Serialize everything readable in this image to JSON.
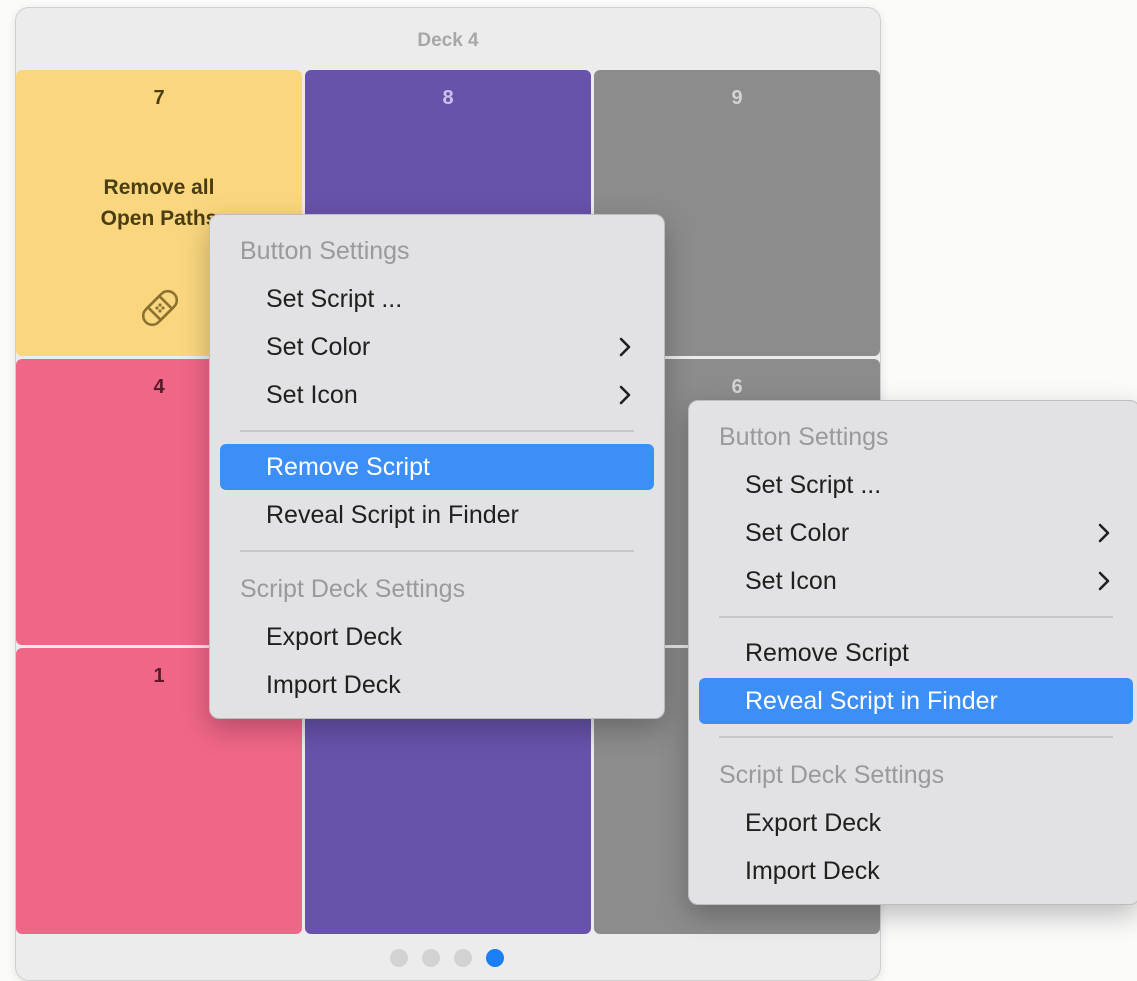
{
  "window": {
    "title": "Deck 4"
  },
  "grid": {
    "cells": [
      {
        "number": "7",
        "label": "Remove all\nOpen Paths",
        "color": "#fad77f",
        "icon": "bandage-icon"
      },
      {
        "number": "8",
        "label": "",
        "color": "#6753aa"
      },
      {
        "number": "9",
        "label": "",
        "color": "#8c8c8c"
      },
      {
        "number": "4",
        "label": "",
        "color": "#f06687"
      },
      {
        "number": "6",
        "label": "",
        "color": "#8c8c8c"
      },
      {
        "number": "1",
        "label": "",
        "color": "#f06687"
      },
      {
        "number": "",
        "label": "",
        "color": "#6753aa"
      },
      {
        "number": "",
        "label": "",
        "color": "#8c8c8c"
      }
    ]
  },
  "page_indicator": {
    "pages": 4,
    "current": 4
  },
  "menus": [
    {
      "button_header": "Button Settings",
      "set_script": "Set Script ...",
      "set_color": "Set Color",
      "set_icon": "Set Icon",
      "remove_script": "Remove Script",
      "reveal_script": "Reveal Script in Finder",
      "deck_header": "Script Deck Settings",
      "export_deck": "Export Deck",
      "import_deck": "Import Deck",
      "highlighted": "Remove Script"
    },
    {
      "button_header": "Button Settings",
      "set_script": "Set Script ...",
      "set_color": "Set Color",
      "set_icon": "Set Icon",
      "remove_script": "Remove Script",
      "reveal_script": "Reveal Script in Finder",
      "deck_header": "Script Deck Settings",
      "export_deck": "Export Deck",
      "import_deck": "Import Deck",
      "highlighted": "Reveal Script in Finder"
    }
  ],
  "colors": {
    "accent": "#3d8ff8",
    "page_dot_active": "#1a7ef5"
  }
}
